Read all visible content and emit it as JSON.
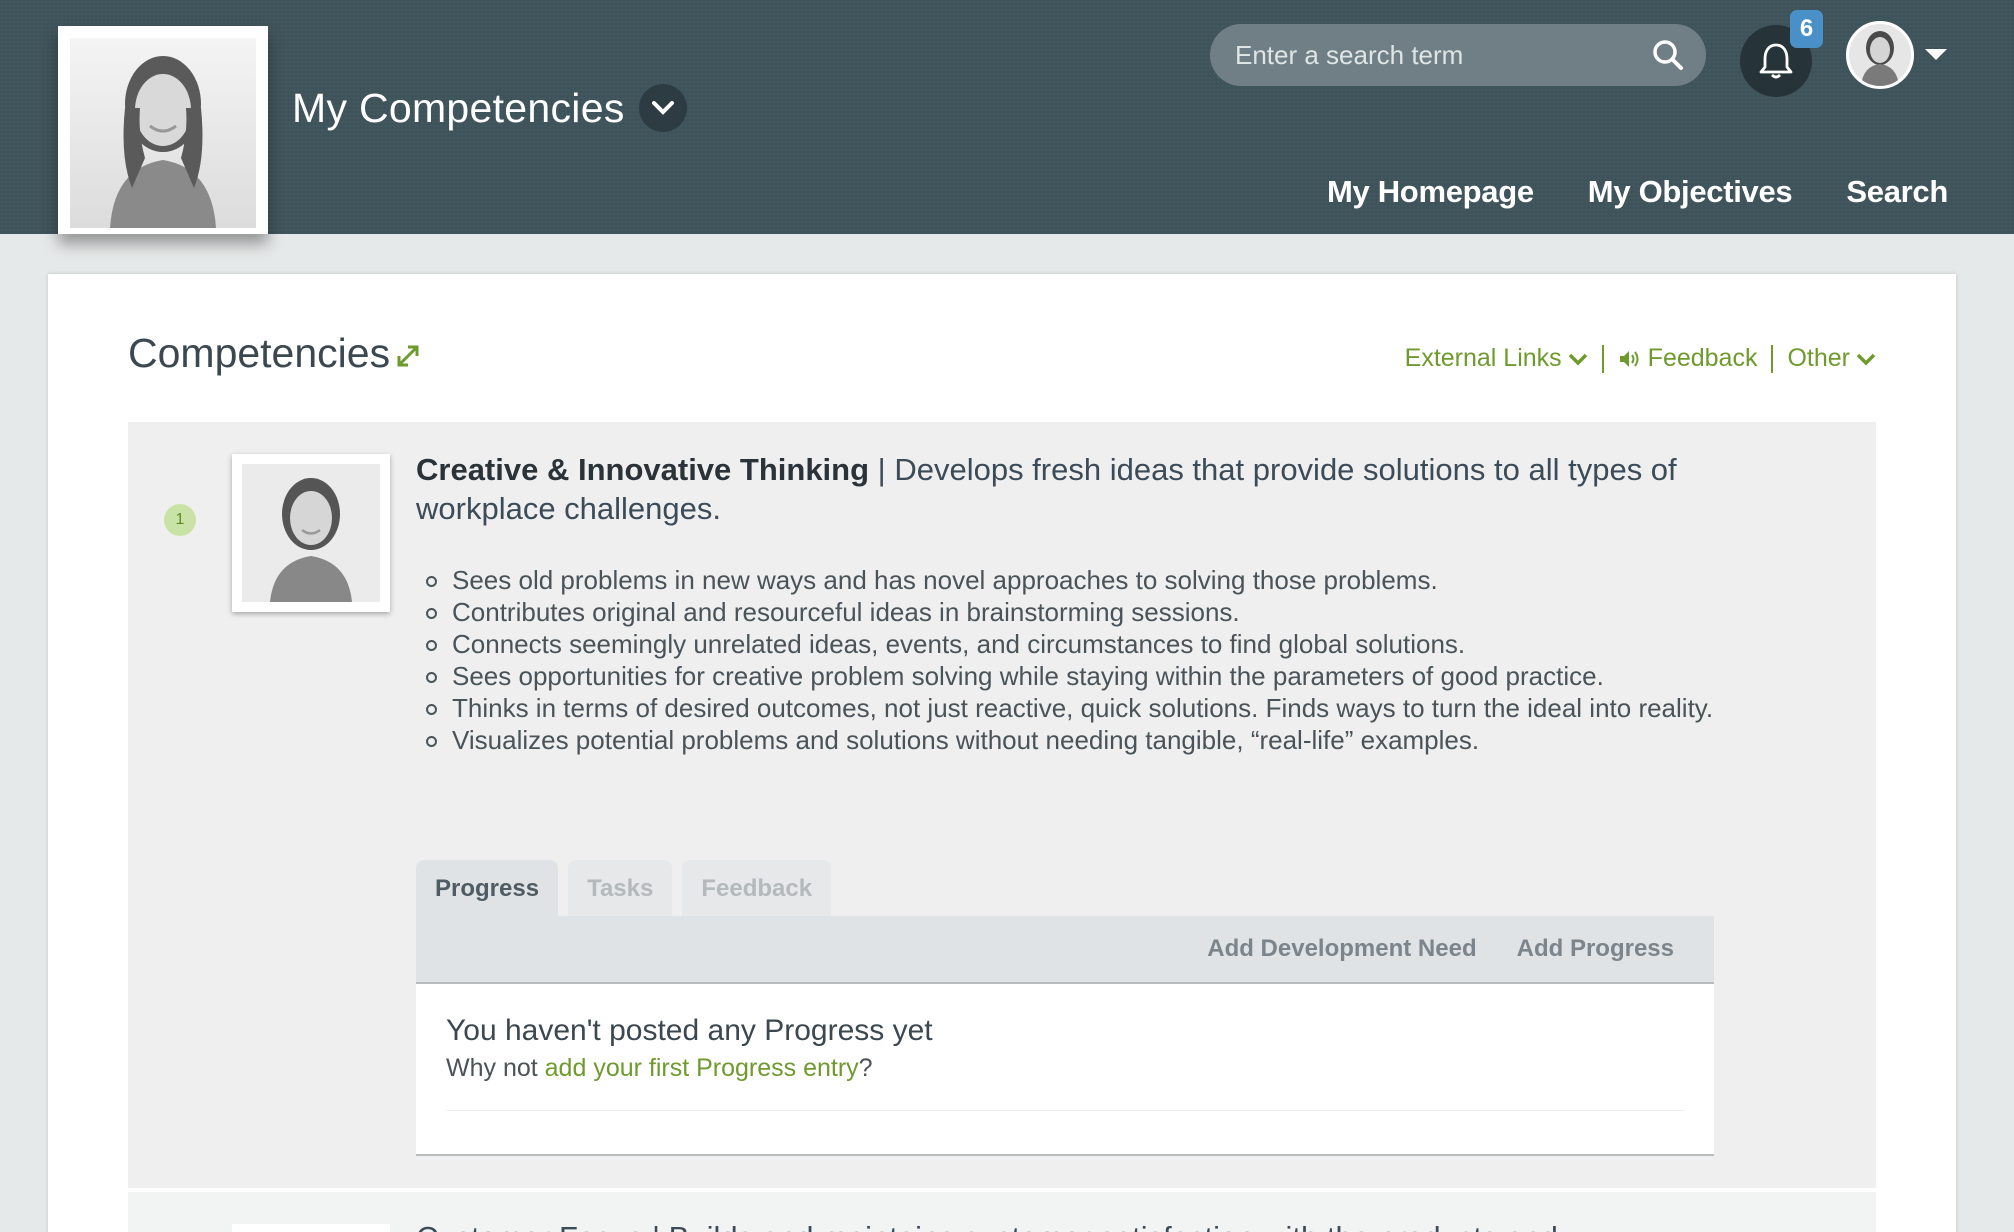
{
  "header": {
    "page_title": "My Competencies",
    "search_placeholder": "Enter a search term",
    "notification_count": "6",
    "nav": [
      "My Homepage",
      "My Objectives",
      "Search"
    ]
  },
  "section": {
    "title": "Competencies",
    "links": {
      "external": "External Links",
      "feedback": "Feedback",
      "other": "Other"
    }
  },
  "competency": {
    "number": "1",
    "name": "Creative & Innovative Thinking",
    "separator": " | ",
    "description": "Develops fresh ideas that provide solutions to all types of workplace challenges.",
    "behaviours": [
      "Sees old problems in new ways and has novel approaches to solving those problems.",
      "Contributes original and resourceful ideas in brainstorming sessions.",
      "Connects seemingly unrelated ideas, events, and circumstances to find global solutions.",
      "Sees opportunities for creative problem solving while staying within the parameters of good practice.",
      "Thinks in terms of desired outcomes, not just reactive, quick solutions. Finds ways to turn the ideal into reality.",
      "Visualizes potential problems and solutions without needing tangible, “real-life” examples."
    ],
    "tabs": [
      "Progress",
      "Tasks",
      "Feedback"
    ],
    "actions": {
      "add_need": "Add Development Need",
      "add_progress": "Add Progress"
    },
    "empty": {
      "title": "You haven't posted any Progress yet",
      "prefix": "Why not ",
      "link": "add your first Progress entry",
      "suffix": "?"
    }
  },
  "next_competency": {
    "heading": "Customer Focus | Builds and maintains customer satisfaction with the products and"
  },
  "colors": {
    "header_bg": "#3f535b",
    "accent_green": "#6f9a2e",
    "badge_blue": "#4a90c8"
  }
}
